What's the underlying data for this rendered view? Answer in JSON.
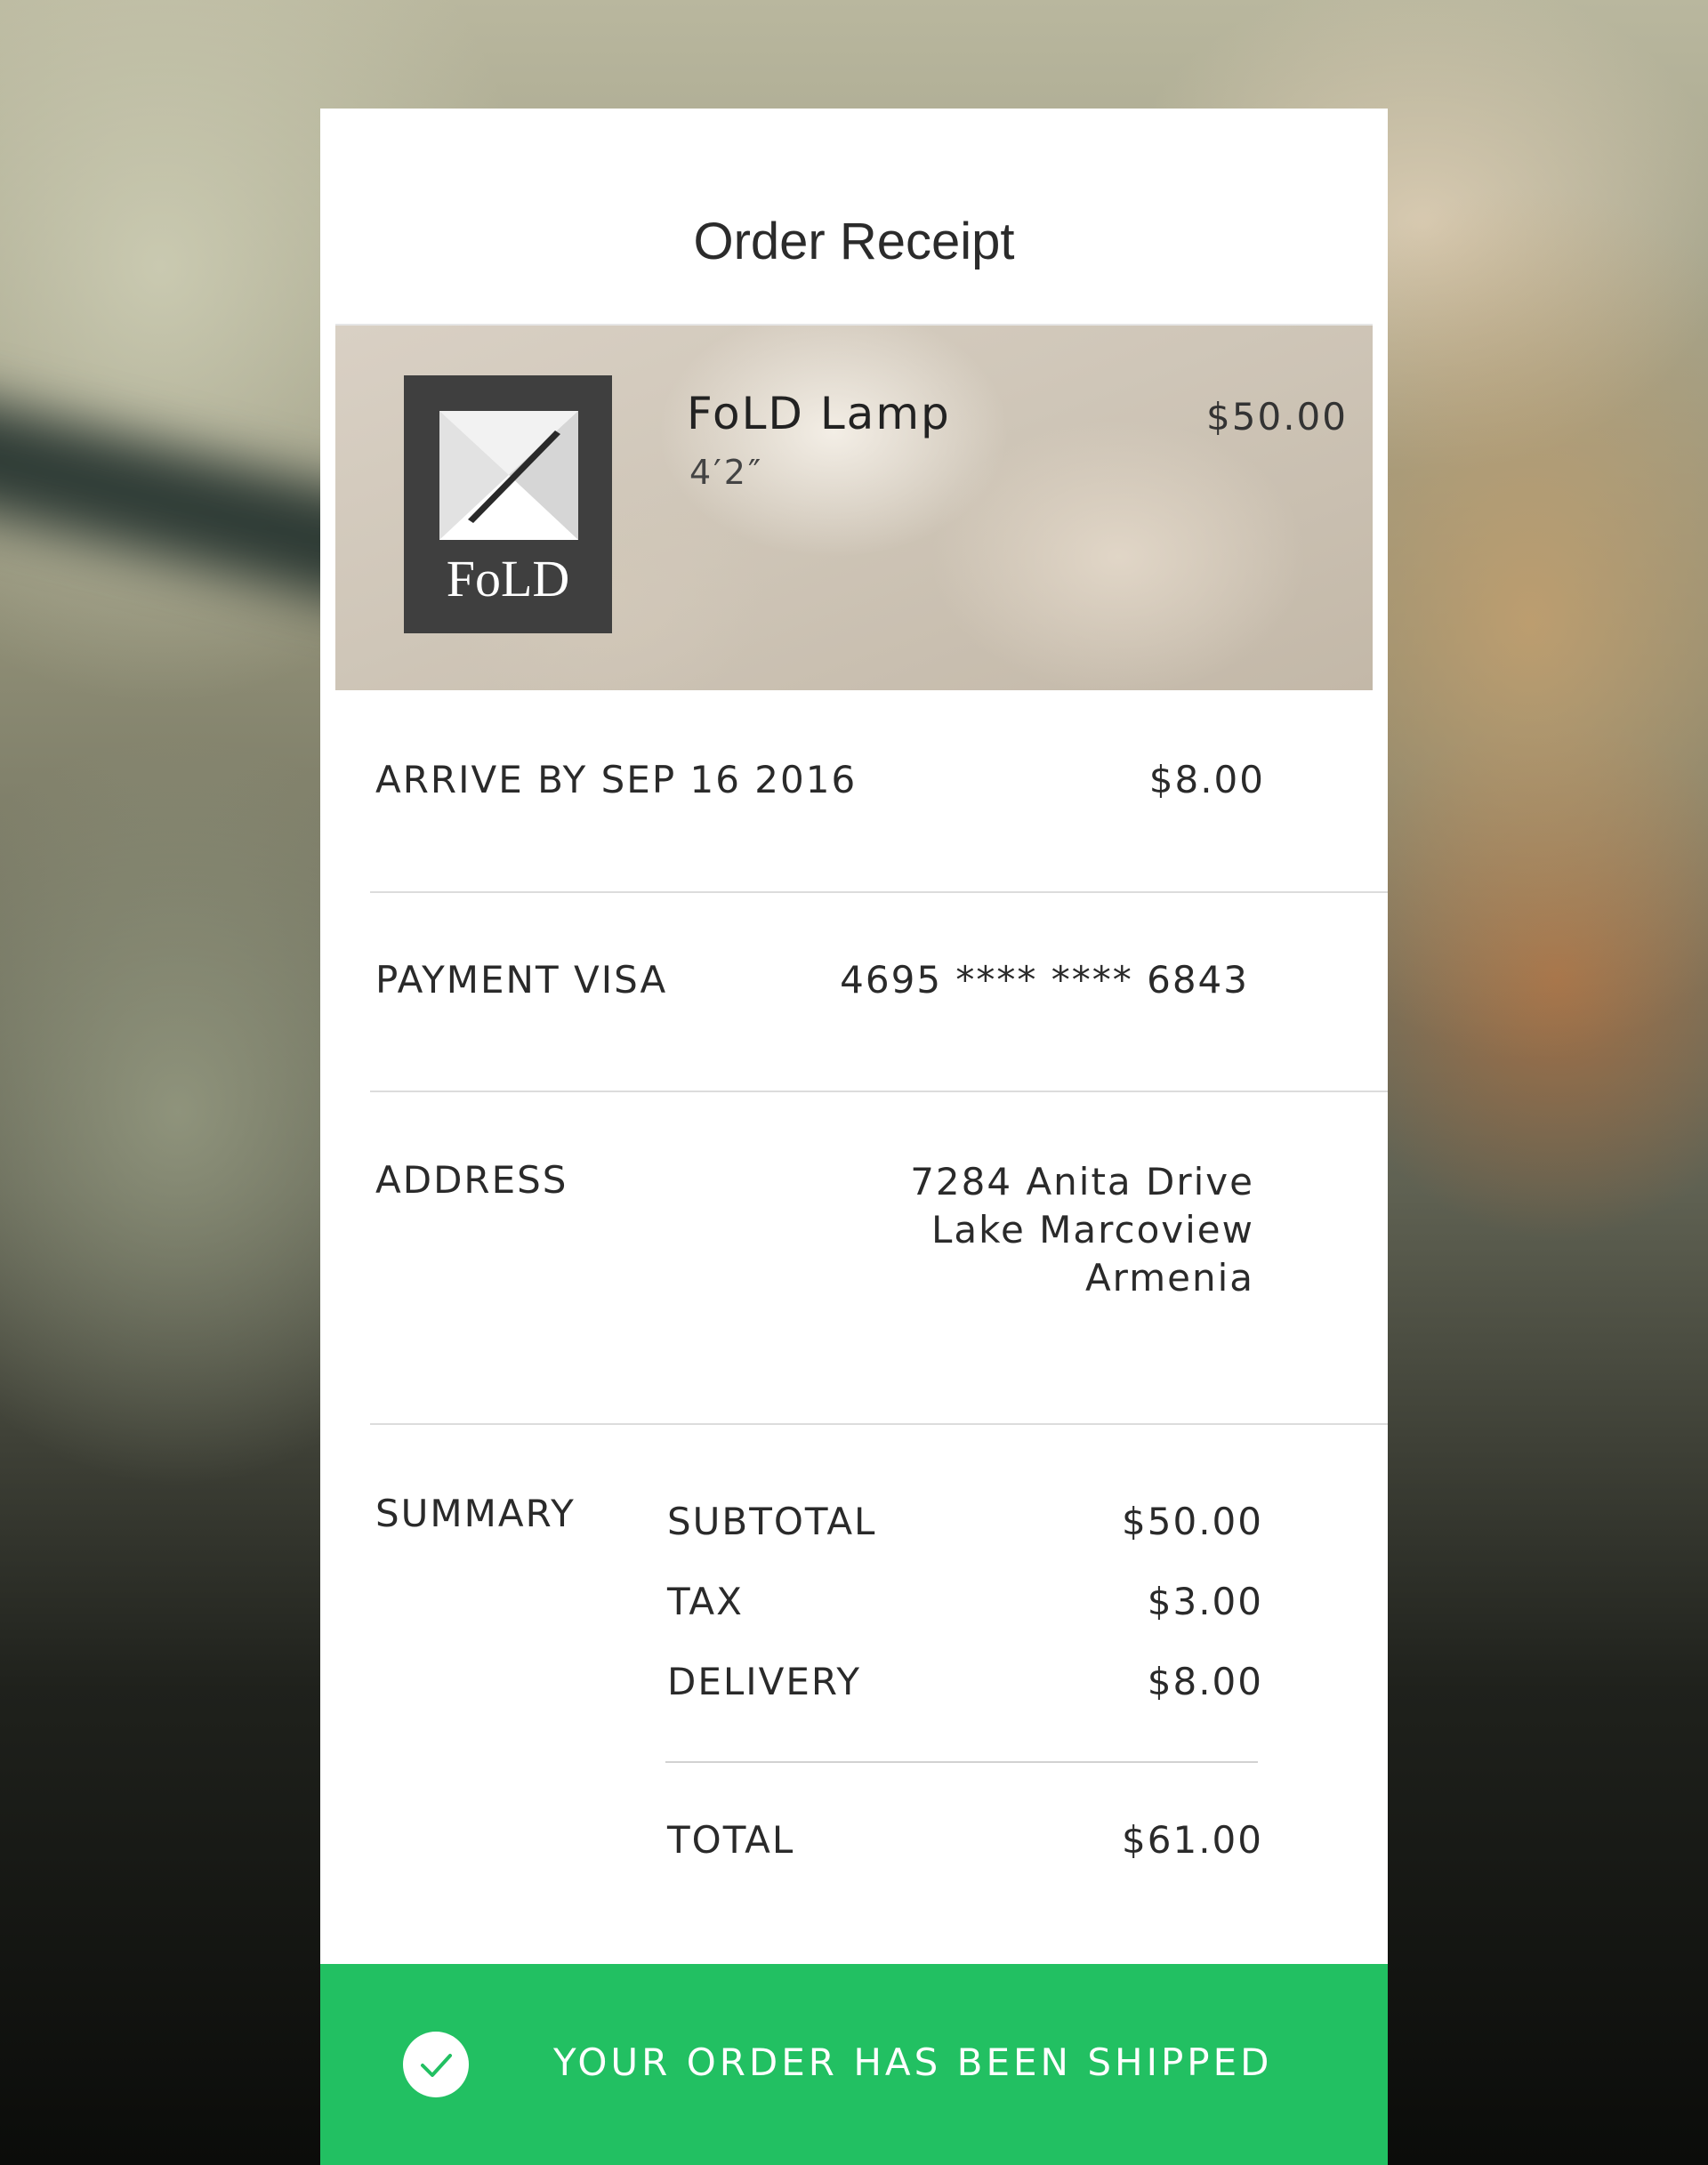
{
  "header": {
    "title": "Order Receipt"
  },
  "product": {
    "brand_logo_text": "FoLD",
    "name": "FoLD Lamp",
    "size": "4′2″",
    "price": "$50.00"
  },
  "delivery": {
    "label": "ARRIVE BY SEP 16 2016",
    "value": "$8.00"
  },
  "payment": {
    "label": "PAYMENT VISA",
    "value": "4695 **** **** 6843"
  },
  "address": {
    "label": "ADDRESS",
    "lines": [
      "7284 Anita Drive",
      "Lake Marcoview",
      "Armenia"
    ]
  },
  "summary": {
    "label": "SUMMARY",
    "items": [
      {
        "label": "SUBTOTAL",
        "value": "$50.00"
      },
      {
        "label": "TAX",
        "value": "$3.00"
      },
      {
        "label": "DELIVERY",
        "value": "$8.00"
      }
    ],
    "total": {
      "label": "TOTAL",
      "value": "$61.00"
    }
  },
  "status_banner": {
    "text": "YOUR ORDER HAS BEEN SHIPPED",
    "icon": "checkmark-circle-icon",
    "color": "#22c062"
  }
}
